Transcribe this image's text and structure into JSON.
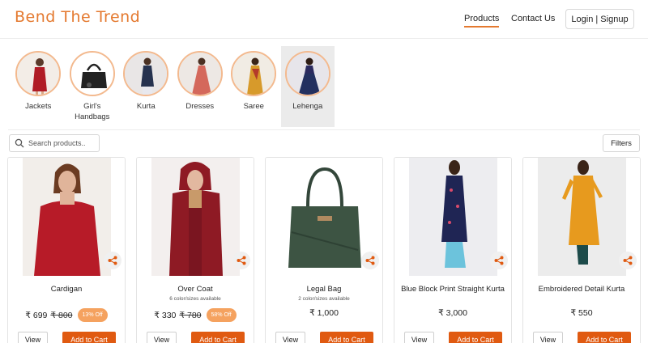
{
  "header": {
    "logo": "Bend The Trend",
    "nav": {
      "products": "Products",
      "contact": "Contact Us"
    },
    "login_label": "Login | Signup",
    "accent_color": "#e4792f"
  },
  "categories": [
    {
      "label": "Jackets",
      "icon": "jacket-thumb"
    },
    {
      "label": "Girl's Handbags",
      "icon": "handbag-thumb"
    },
    {
      "label": "Kurta",
      "icon": "kurta-thumb"
    },
    {
      "label": "Dresses",
      "icon": "dress-thumb"
    },
    {
      "label": "Saree",
      "icon": "saree-thumb"
    },
    {
      "label": "Lehenga",
      "icon": "lehenga-thumb",
      "selected": true
    }
  ],
  "search": {
    "placeholder": "Search products..",
    "icon": "search-icon"
  },
  "filters_label": "Filters",
  "products": [
    {
      "title": "Cardigan",
      "subtitle": "",
      "price": "₹ 699",
      "old_price": "₹ 800",
      "discount": "13% Off",
      "view_label": "View",
      "cart_label": "Add to Cart"
    },
    {
      "title": "Over Coat",
      "subtitle": "6 color/sizes available",
      "price": "₹ 330",
      "old_price": "₹ 780",
      "discount": "58% Off",
      "view_label": "View",
      "cart_label": "Add to Cart"
    },
    {
      "title": "Legal Bag",
      "subtitle": "2 color/sizes available",
      "price": "₹ 1,000",
      "old_price": "",
      "discount": "",
      "view_label": "View",
      "cart_label": "Add to Cart"
    },
    {
      "title": "Blue Block Print Straight Kurta",
      "subtitle": "",
      "price": "₹ 3,000",
      "old_price": "",
      "discount": "",
      "view_label": "View",
      "cart_label": "Add to Cart"
    },
    {
      "title": "Embroidered Detail Kurta",
      "subtitle": "",
      "price": "₹ 550",
      "old_price": "",
      "discount": "",
      "view_label": "View",
      "cart_label": "Add to Cart"
    }
  ],
  "colors": {
    "cart_button": "#e05a11",
    "discount_badge": "#f5a25f"
  }
}
